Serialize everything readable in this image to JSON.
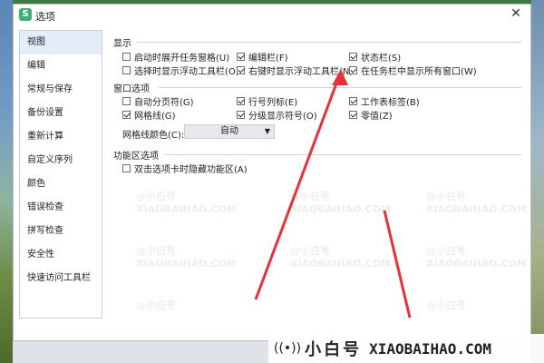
{
  "window": {
    "title": "选项",
    "app_logo": "S"
  },
  "sidebar": {
    "items": [
      {
        "label": "视图"
      },
      {
        "label": "编辑"
      },
      {
        "label": "常规与保存"
      },
      {
        "label": "备份设置"
      },
      {
        "label": "重新计算"
      },
      {
        "label": "自定义序列"
      },
      {
        "label": "颜色"
      },
      {
        "label": "错误检查"
      },
      {
        "label": "拼写检查"
      },
      {
        "label": "安全性"
      },
      {
        "label": "快速访问工具栏"
      }
    ],
    "active_index": 0
  },
  "display": {
    "title": "显示",
    "options": [
      {
        "label": "启动时展开任务窗格(U)",
        "checked": false
      },
      {
        "label": "编辑栏(F)",
        "checked": true
      },
      {
        "label": "状态栏(S)",
        "checked": true
      },
      {
        "label": "选择时显示浮动工具栏(O)",
        "checked": false
      },
      {
        "label": "右键时显示浮动工具栏(N)",
        "checked": true
      },
      {
        "label": "在任务栏中显示所有窗口(W)",
        "checked": true
      }
    ]
  },
  "window_options": {
    "title": "窗口选项",
    "options": [
      {
        "label": "自动分页符(G)",
        "checked": false
      },
      {
        "label": "行号列标(E)",
        "checked": true
      },
      {
        "label": "工作表标签(B)",
        "checked": true
      },
      {
        "label": "网格线(G)",
        "checked": true
      },
      {
        "label": "分级显示符号(O)",
        "checked": true
      },
      {
        "label": "零值(Z)",
        "checked": true
      }
    ],
    "gridline_color_label": "网格线颜色(C):",
    "gridline_color_value": "自动"
  },
  "ribbon": {
    "title": "功能区选项",
    "options": [
      {
        "label": "双击选项卡时隐藏功能区(A)",
        "checked": false
      }
    ]
  },
  "watermark": {
    "brand_cn": "小白号",
    "brand_en": "XIAOBAIHAO.COM",
    "small_cn": "@小白号",
    "small_en": "XIAOBAIHAO.COM"
  },
  "annotation_arrows": "red arrows pointing to 在任务栏中显示所有窗口 checkbox",
  "colors": {
    "accent_arrow": "#e8313a",
    "active_item_bg": "#e3edf9",
    "logo_green": "#3cb371"
  }
}
